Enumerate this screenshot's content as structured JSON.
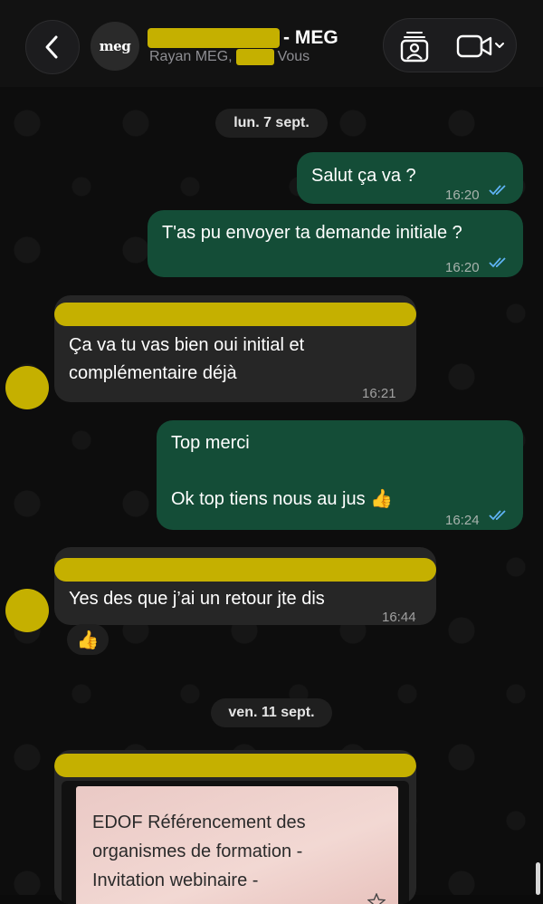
{
  "header": {
    "avatar_text": "meg",
    "title_suffix": "- MEG",
    "subtitle_prefix": "Rayan MEG,",
    "subtitle_suffix": "Vous"
  },
  "dates": {
    "first": "lun. 7 sept.",
    "second": "ven. 11 sept."
  },
  "messages": [
    {
      "direction": "out",
      "text": "Salut ça va ?",
      "time": "16:20",
      "read": true
    },
    {
      "direction": "out",
      "text": "T'as pu envoyer ta demande initiale ?",
      "time": "16:20",
      "read": true
    },
    {
      "direction": "in",
      "text": "Ça va tu vas bien oui initial et\ncomplémentaire déjà",
      "time": "16:21"
    },
    {
      "direction": "out",
      "text": "Top merci\n\nOk top tiens nous au jus 👍",
      "time": "16:24",
      "read": true
    },
    {
      "direction": "in",
      "text": "Yes des que j’ai un retour jte dis",
      "time": "16:44",
      "reaction": "👍"
    }
  ],
  "document": {
    "title": "EDOF Référencement des organismes de formation - Invitation webinaire -"
  },
  "colors": {
    "outgoing_bubble": "#144d37",
    "incoming_bubble": "#262626",
    "redaction": "#c5b000",
    "read_ticks": "#5fb3f5"
  }
}
